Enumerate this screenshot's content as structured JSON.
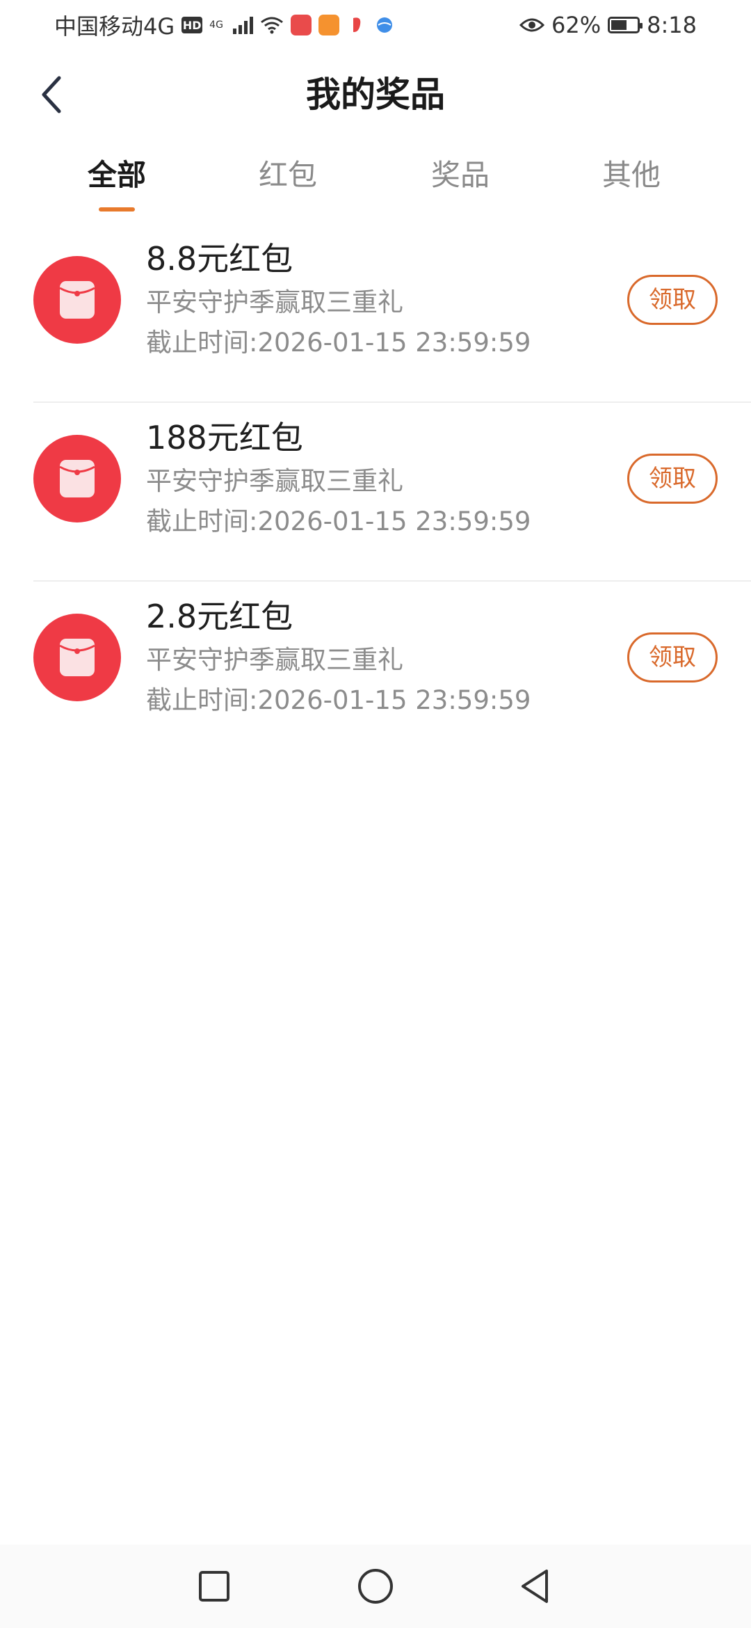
{
  "status_bar": {
    "carrier": "中国移动4G",
    "hd": "HD",
    "network": "4G",
    "battery_percent": "62%",
    "battery_level": 0.62,
    "time": "8:18"
  },
  "header": {
    "title": "我的奖品"
  },
  "tabs": [
    {
      "label": "全部",
      "active": true
    },
    {
      "label": "红包",
      "active": false
    },
    {
      "label": "奖品",
      "active": false
    },
    {
      "label": "其他",
      "active": false
    }
  ],
  "prizes": [
    {
      "title": "8.8元红包",
      "description": "平安守护季赢取三重礼",
      "deadline": "截止时间:2026-01-15 23:59:59",
      "action": "领取"
    },
    {
      "title": "188元红包",
      "description": "平安守护季赢取三重礼",
      "deadline": "截止时间:2026-01-15 23:59:59",
      "action": "领取"
    },
    {
      "title": "2.8元红包",
      "description": "平安守护季赢取三重礼",
      "deadline": "截止时间:2026-01-15 23:59:59",
      "action": "领取"
    }
  ],
  "colors": {
    "accent": "#e87a2c",
    "claim": "#d9692b",
    "red_packet": "#ef3a45"
  },
  "icons": {
    "back": "chevron-left-icon",
    "red_packet": "red-envelope-icon",
    "nav_recent": "square-icon",
    "nav_home": "circle-icon",
    "nav_back": "triangle-back-icon"
  }
}
